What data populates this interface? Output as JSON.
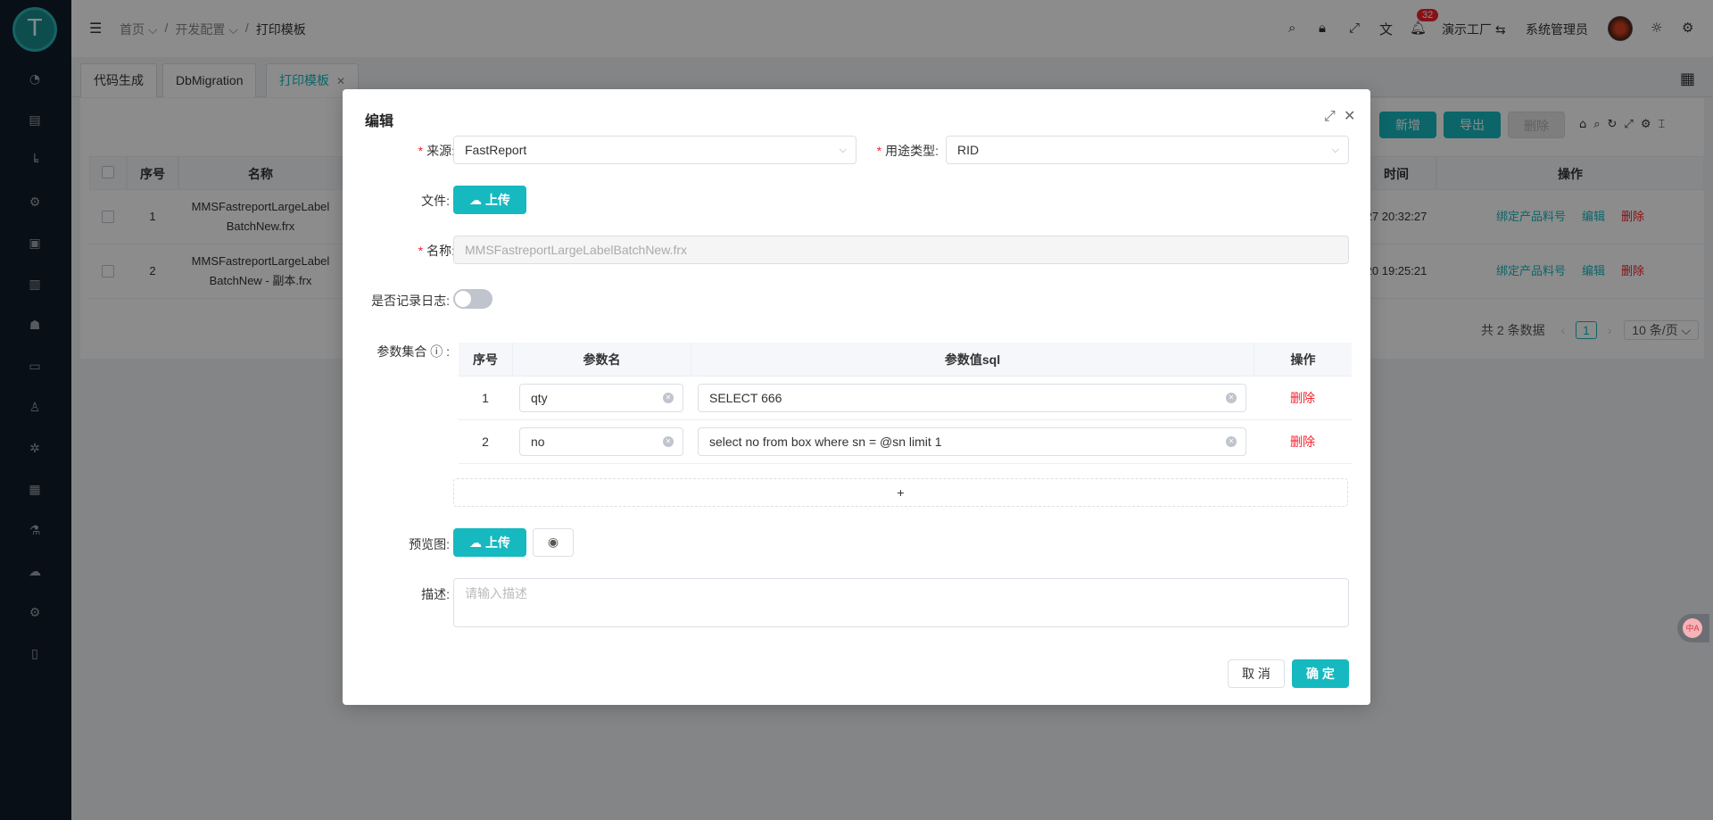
{
  "sidebar": {
    "logo_text": "T",
    "icons": [
      "dashboard-icon",
      "document-icon",
      "chart-line-icon",
      "settings-flow-icon",
      "terminal-icon",
      "building-icon",
      "robot-icon",
      "database-icon",
      "user-icon",
      "bug-icon",
      "bar-chart-icon",
      "flask-icon",
      "cloud-icon",
      "gear-icon",
      "calculator-icon"
    ]
  },
  "header": {
    "breadcrumb": [
      "首页",
      "开发配置",
      "打印模板"
    ],
    "notification_count": "32",
    "factory": "演示工厂",
    "user": "系统管理员"
  },
  "tabs": [
    {
      "label": "代码生成"
    },
    {
      "label": "DbMigration"
    },
    {
      "label": "打印模板"
    }
  ],
  "page": {
    "buttons": {
      "add": "新增",
      "export": "导出",
      "delete": "删除"
    },
    "table": {
      "headers": {
        "index": "序号",
        "name": "名称",
        "time": "时间",
        "actions": "操作"
      },
      "rows": [
        {
          "index": "1",
          "name_l1": "MMSFastreportLargeLabel",
          "name_l2": "BatchNew.frx",
          "time": "27 20:32:27",
          "bind": "绑定产品料号",
          "edit": "编辑",
          "del": "删除"
        },
        {
          "index": "2",
          "name_l1": "MMSFastreportLargeLabel",
          "name_l2": "BatchNew - 副本.frx",
          "time": "20 19:25:21",
          "bind": "绑定产品料号",
          "edit": "编辑",
          "del": "删除"
        }
      ]
    },
    "pager": {
      "total": "共 2 条数据",
      "page": "1",
      "size": "10 条/页"
    }
  },
  "modal": {
    "title": "编辑",
    "source_label": "来源:",
    "source_value": "FastReport",
    "usage_label": "用途类型:",
    "usage_value": "RID",
    "file_label": "文件:",
    "upload_label": "上传",
    "name_label": "名称:",
    "name_value": "MMSFastreportLargeLabelBatchNew.frx",
    "log_label": "是否记录日志:",
    "params_label": "参数集合",
    "params_headers": {
      "index": "序号",
      "name": "参数名",
      "sql": "参数值sql",
      "op": "操作"
    },
    "params": [
      {
        "index": "1",
        "name": "qty",
        "sql": "SELECT 666",
        "op": "删除"
      },
      {
        "index": "2",
        "name": "no",
        "sql": "select no from box where sn = @sn limit 1",
        "op": "删除"
      }
    ],
    "add_row": "+",
    "preview_label": "预览图:",
    "desc_label": "描述:",
    "desc_placeholder": "请输入描述",
    "cancel": "取 消",
    "ok": "确 定"
  },
  "colors": {
    "accent": "#16b9c0",
    "danger": "#f5222d",
    "sidebar": "#0f1d28"
  }
}
